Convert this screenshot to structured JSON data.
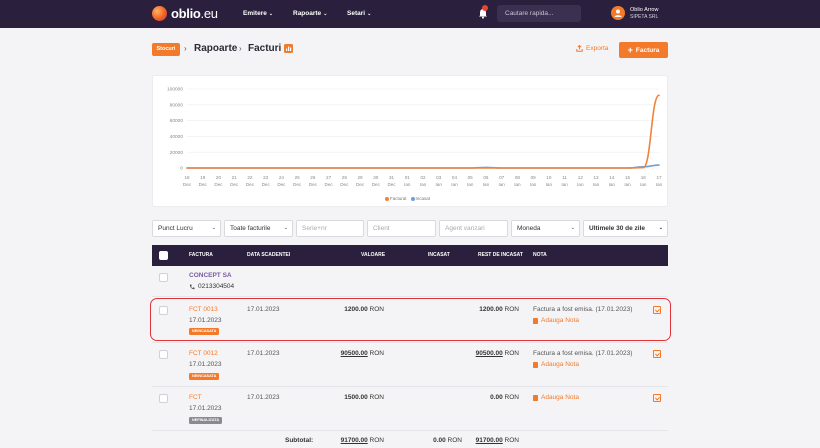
{
  "topnav": {
    "brand": "oblio",
    "brand_tld": ".eu",
    "menu": [
      {
        "label": "Emitere"
      },
      {
        "label": "Rapoarte"
      },
      {
        "label": "Setari"
      }
    ],
    "search_placeholder": "Cautare rapida...",
    "user_name": "Oblio Arrow",
    "user_company": "SIPETA SRL"
  },
  "breadcrumb": {
    "chip": "Stocuri",
    "level1": "Rapoarte",
    "level2": "Facturi"
  },
  "actions": {
    "export_label": "Exporta",
    "new_label": "Factura"
  },
  "chart_data": {
    "type": "line",
    "x": [
      "18 Dec",
      "19 Dec",
      "20 Dec",
      "21 Dec",
      "22 Dec",
      "23 Dec",
      "24 Dec",
      "25 Dec",
      "26 Dec",
      "27 Dec",
      "28 Dec",
      "29 Dec",
      "30 Dec",
      "31 Dec",
      "01 Ian",
      "02 Ian",
      "03 Ian",
      "04 Ian",
      "05 Ian",
      "06 Ian",
      "07 Ian",
      "08 Ian",
      "09 Ian",
      "10 Ian",
      "11 Ian",
      "12 Ian",
      "13 Ian",
      "14 Ian",
      "15 Ian",
      "16 Ian",
      "17 Ian"
    ],
    "x_ticks": [
      [
        "18",
        "Dec"
      ],
      [
        "19",
        "Dec"
      ],
      [
        "20",
        "Dec"
      ],
      [
        "21",
        "Dec"
      ],
      [
        "22",
        "Dec"
      ],
      [
        "23",
        "Dec"
      ],
      [
        "24",
        "Dec"
      ],
      [
        "25",
        "Dec"
      ],
      [
        "26",
        "Dec"
      ],
      [
        "27",
        "Dec"
      ],
      [
        "28",
        "Dec"
      ],
      [
        "29",
        "Dec"
      ],
      [
        "30",
        "Dec"
      ],
      [
        "31",
        "Dec"
      ],
      [
        "01",
        "Ian"
      ],
      [
        "02",
        "Ian"
      ],
      [
        "03",
        "Ian"
      ],
      [
        "04",
        "Ian"
      ],
      [
        "05",
        "Ian"
      ],
      [
        "06",
        "Ian"
      ],
      [
        "07",
        "Ian"
      ],
      [
        "08",
        "Ian"
      ],
      [
        "09",
        "Ian"
      ],
      [
        "10",
        "Ian"
      ],
      [
        "11",
        "Ian"
      ],
      [
        "12",
        "Ian"
      ],
      [
        "13",
        "Ian"
      ],
      [
        "14",
        "Ian"
      ],
      [
        "15",
        "Ian"
      ],
      [
        "16",
        "Ian"
      ],
      [
        "17",
        "Ian"
      ]
    ],
    "y_ticks": [
      "100000",
      "80000",
      "60000",
      "40000",
      "20000",
      "0"
    ],
    "ylim": [
      0,
      100000
    ],
    "series": [
      {
        "name": "Facturat",
        "color": "#f0823a",
        "values": [
          0,
          0,
          0,
          0,
          0,
          0,
          0,
          0,
          0,
          0,
          0,
          0,
          0,
          0,
          0,
          0,
          0,
          0,
          0,
          0,
          0,
          0,
          0,
          0,
          0,
          0,
          0,
          0,
          0,
          500,
          92000
        ]
      },
      {
        "name": "Incasat",
        "color": "#6f9fd8",
        "values": [
          0,
          0,
          0,
          0,
          0,
          0,
          0,
          0,
          0,
          0,
          0,
          0,
          0,
          0,
          0,
          0,
          0,
          0,
          0,
          800,
          0,
          0,
          0,
          0,
          0,
          0,
          0,
          0,
          0,
          1500,
          3700
        ]
      }
    ],
    "legend_position": "bottom-center",
    "grid": true
  },
  "filters": {
    "punct_lucru": "Punct Lucru",
    "toate_facturile": "Toate facturile",
    "serie_placeholder": "Serie+nr",
    "client_placeholder": "Client",
    "agent_placeholder": "Agent vanzari",
    "moneda": "Moneda",
    "period": "Ultimele 30 de zile"
  },
  "table": {
    "headers": [
      "FACTURA",
      "DATA SCADENTEI",
      "VALOARE",
      "INCASAT",
      "REST DE INCASAT",
      "NOTA"
    ],
    "group": {
      "name": "CONCEPT SA",
      "phone": "0213304504"
    },
    "rows": [
      {
        "number": "FCT 0013",
        "date": "17.01.2023",
        "status": "NEINCASATA",
        "due": "17.01.2023",
        "value": "1200.00",
        "value_cur": "RON",
        "paid": "",
        "rest": "1200.00",
        "rest_cur": "RON",
        "note": "Factura a fost emisa. (17.01.2023)",
        "add_note": "Adauga Nota"
      },
      {
        "number": "FCT 0012",
        "date": "17.01.2023",
        "status": "NEINCASATA",
        "due": "17.01.2023",
        "value": "90500.00",
        "value_cur": "RON",
        "paid": "",
        "rest": "90500.00",
        "rest_cur": "RON",
        "note": "Factura a fost emisa. (17.01.2023)",
        "add_note": "Adauga Nota"
      },
      {
        "number": "FCT",
        "date": "17.01.2023",
        "status": "NEFINALIZATA",
        "due": "17.01.2023",
        "value": "1500.00",
        "value_cur": "RON",
        "paid": "",
        "rest": "0.00",
        "rest_cur": "RON",
        "note": "",
        "add_note": "Adauga Nota"
      }
    ],
    "subtotal": {
      "label": "Subtotal:",
      "value": "91700.00",
      "value_cur": "RON",
      "paid": "0.00",
      "paid_cur": "RON",
      "rest": "91700.00",
      "rest_cur": "RON"
    }
  }
}
